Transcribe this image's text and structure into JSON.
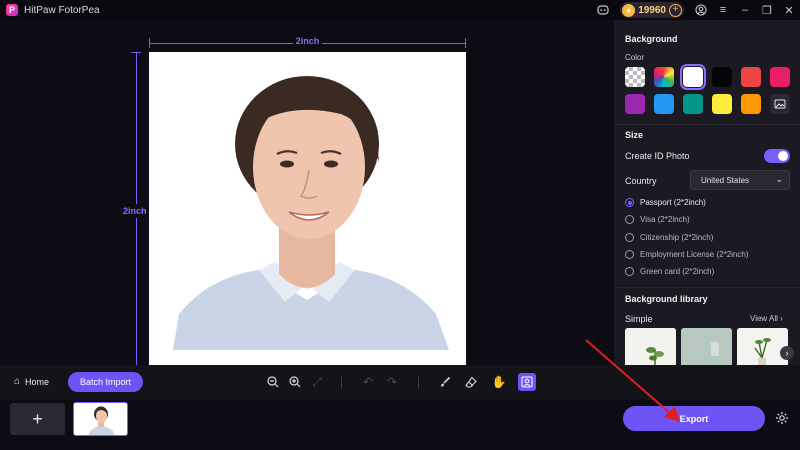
{
  "app": {
    "title": "HitPaw FotorPea"
  },
  "titlebar": {
    "coins": "19960"
  },
  "canvas": {
    "width_label": "2inch",
    "height_label": "2inch"
  },
  "panel": {
    "background_title": "Background",
    "color_label": "Color",
    "swatches": [
      {
        "name": "transparent",
        "color": "checker"
      },
      {
        "name": "rainbow",
        "color": "rainbow"
      },
      {
        "name": "white",
        "color": "#ffffff",
        "selected": true
      },
      {
        "name": "black",
        "color": "#050505"
      },
      {
        "name": "red",
        "color": "#ef4444"
      },
      {
        "name": "pink",
        "color": "#e91e63"
      },
      {
        "name": "purple",
        "color": "#9c27b0"
      },
      {
        "name": "blue",
        "color": "#2196f3"
      },
      {
        "name": "teal",
        "color": "#009688"
      },
      {
        "name": "yellow",
        "color": "#ffeb3b"
      },
      {
        "name": "orange",
        "color": "#ff9800"
      },
      {
        "name": "custom-image",
        "color": "#2a2932"
      }
    ],
    "size_title": "Size",
    "create_id_label": "Create ID Photo",
    "country_label": "Country",
    "country_value": "United States",
    "radio_options": [
      {
        "label": "Passport (2*2inch)",
        "selected": true
      },
      {
        "label": "Visa (2*2inch)",
        "selected": false
      },
      {
        "label": "Citizenship (2*2inch)",
        "selected": false
      },
      {
        "label": "Employment License (2*2inch)",
        "selected": false
      },
      {
        "label": "Green card (2*2inch)",
        "selected": false
      }
    ],
    "library_title": "Background library",
    "simple_label": "Simple",
    "view_all": "View All"
  },
  "toolbar": {
    "home_label": "Home",
    "batch_label": "Batch Import"
  },
  "bottom": {
    "add_label": "+",
    "export_label": "Export"
  },
  "colors": {
    "accent": "#6d55f5",
    "dimension": "#7b5cff"
  }
}
